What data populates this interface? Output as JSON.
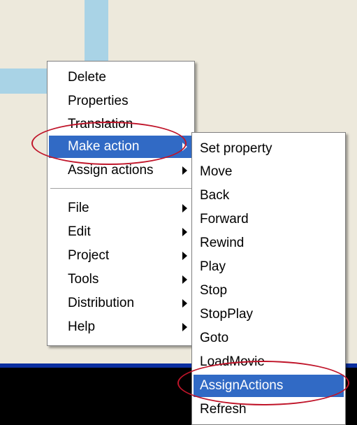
{
  "colors": {
    "desktop_bg": "#ede9dc",
    "accent_stripe": "#a9d3e6",
    "menu_bg": "#ffffff",
    "selection_bg": "#316ac5",
    "selection_text": "#ffffff",
    "annotation_ellipse": "#c0152a",
    "bottom_band": "#000000",
    "bottom_band_edge": "#0b2fa0"
  },
  "context_menu": {
    "items": [
      {
        "label": "Delete",
        "has_submenu": false
      },
      {
        "label": "Properties",
        "has_submenu": false
      },
      {
        "label": "Translation",
        "has_submenu": false
      },
      {
        "label": "Make action",
        "has_submenu": true,
        "selected": true
      },
      {
        "label": "Assign actions",
        "has_submenu": true
      },
      {
        "label": "File",
        "has_submenu": true
      },
      {
        "label": "Edit",
        "has_submenu": true
      },
      {
        "label": "Project",
        "has_submenu": true
      },
      {
        "label": "Tools",
        "has_submenu": true
      },
      {
        "label": "Distribution",
        "has_submenu": true
      },
      {
        "label": "Help",
        "has_submenu": true
      }
    ]
  },
  "make_action_submenu": {
    "items": [
      {
        "label": "Set property"
      },
      {
        "label": "Move"
      },
      {
        "label": "Back"
      },
      {
        "label": "Forward"
      },
      {
        "label": "Rewind"
      },
      {
        "label": "Play"
      },
      {
        "label": "Stop"
      },
      {
        "label": "StopPlay"
      },
      {
        "label": "Goto"
      },
      {
        "label": "LoadMovie"
      },
      {
        "label": "AssignActions",
        "selected": true
      },
      {
        "label": "Refresh"
      }
    ]
  },
  "annotations": [
    {
      "target": "Make action",
      "shape": "ellipse"
    },
    {
      "target": "AssignActions",
      "shape": "ellipse"
    }
  ]
}
